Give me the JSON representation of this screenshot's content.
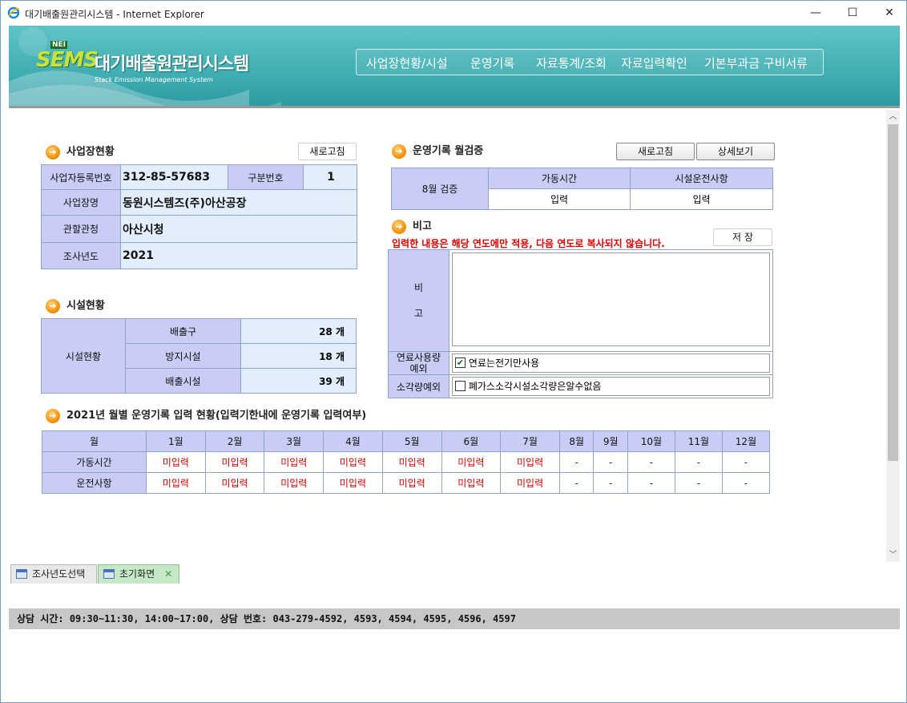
{
  "window": {
    "title": "대기배출원관리시스템 - Internet Explorer",
    "minimize": "—",
    "maximize": "☐",
    "close": "✕"
  },
  "header": {
    "logo_nei": "NEI",
    "logo_sems": "SEMS",
    "logo_title": "대기배출원관리시스템",
    "logo_subtitle": "Stack Emission Management System",
    "nav": [
      "사업장현황/시설",
      "운영기록",
      "자료통계/조회",
      "자료입력확인",
      "기본부과금 구비서류"
    ]
  },
  "business": {
    "section_title": "사업장현황",
    "refresh_label": "새로고침",
    "reg_no_label": "사업자등록번호",
    "reg_no_value": "312-85-57683",
    "div_no_label": "구분번호",
    "div_no_value": "1",
    "name_label": "사업장명",
    "name_value": "동원시스템즈(주)아산공장",
    "authority_label": "관할관청",
    "authority_value": "아산시청",
    "year_label": "조사년도",
    "year_value": "2021"
  },
  "facility": {
    "section_title": "시설현황",
    "group_label": "시설현황",
    "rows": [
      {
        "label": "배출구",
        "value": "28 개"
      },
      {
        "label": "방지시설",
        "value": "18 개"
      },
      {
        "label": "배출시설",
        "value": "39 개"
      }
    ]
  },
  "verify": {
    "section_title": "운영기록 월검증",
    "refresh_label": "새로고침",
    "detail_label": "상세보기",
    "month_label": "8월 검증",
    "col1": "가동시간",
    "col2": "시설운전사항",
    "val1": "입력",
    "val2": "입력"
  },
  "note": {
    "section_title": "비고",
    "notice": "입력한 내용은 해당 연도에만 적용, 다음 연도로 복사되지 않습니다.",
    "save_label": "저 장",
    "label_top": "비",
    "label_bottom": "고",
    "textarea_value": "",
    "fuel_label_1": "연료사용량",
    "fuel_label_2": "예외",
    "fuel_check_label": "연료는전기만사용",
    "fuel_checked": true,
    "incin_label": "소각량예외",
    "incin_check_label": "폐가스소각시설소각량은알수없음",
    "incin_checked": false
  },
  "monthly": {
    "section_title": "2021년 월별 운영기록 입력 현황(입력기한내에 운영기록 입력여부)",
    "header_label": "월",
    "months": [
      "1월",
      "2월",
      "3월",
      "4월",
      "5월",
      "6월",
      "7월",
      "8월",
      "9월",
      "10월",
      "11월",
      "12월"
    ],
    "rows": [
      {
        "label": "가동시간",
        "values": [
          "미입력",
          "미입력",
          "미입력",
          "미입력",
          "미입력",
          "미입력",
          "미입력",
          "-",
          "-",
          "-",
          "-",
          "-"
        ]
      },
      {
        "label": "운전사항",
        "values": [
          "미입력",
          "미입력",
          "미입력",
          "미입력",
          "미입력",
          "미입력",
          "미입력",
          "-",
          "-",
          "-",
          "-",
          "-"
        ]
      }
    ]
  },
  "tabs": [
    {
      "label": "조사년도선택",
      "active": false
    },
    {
      "label": "초기화면",
      "active": true,
      "close": "✕"
    }
  ],
  "status_text": "상담 시간: 09:30~11:30, 14:00~17:00,  상담 번호: 043-279-4592, 4593, 4594, 4595, 4596, 4597",
  "scroll": {
    "up": "︿",
    "down": "﹀"
  },
  "colors": {
    "header_teal": "#3aa9ae",
    "table_header": "#c9cdf5",
    "table_value": "#e2eefb",
    "missing_red": "#d40000"
  }
}
